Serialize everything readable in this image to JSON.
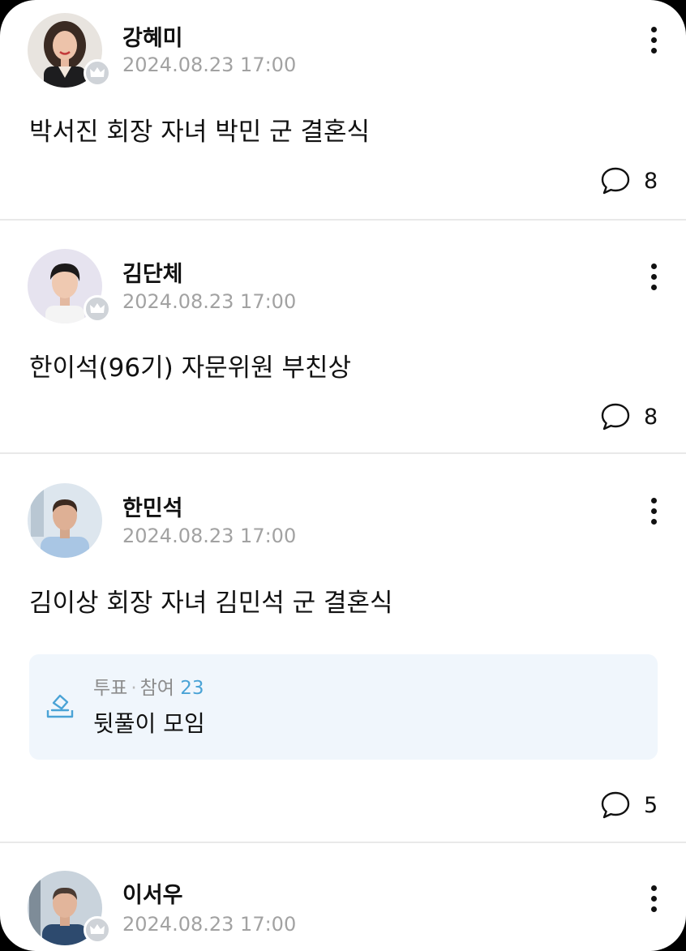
{
  "posts": [
    {
      "author": "강혜미",
      "date": "2024.08.23 17:00",
      "content": "박서진 회장 자녀 박민 군 결혼식",
      "comment_count": "8",
      "has_crown_badge": true
    },
    {
      "author": "김단체",
      "date": "2024.08.23 17:00",
      "content": "한이석(96기) 자문위원 부친상",
      "comment_count": "8",
      "has_crown_badge": true
    },
    {
      "author": "한민석",
      "date": "2024.08.23 17:00",
      "content": "김이상 회장 자녀 김민석 군 결혼식",
      "comment_count": "5",
      "has_crown_badge": false,
      "poll": {
        "type_label": "투표",
        "separator": "·",
        "participation_label": "참여",
        "participation_count": "23",
        "title": "뒷풀이 모임"
      }
    },
    {
      "author": "이서우",
      "date": "2024.08.23 17:00",
      "has_crown_badge": true
    }
  ],
  "icons": {
    "more": "more-vertical-icon",
    "comment": "speech-bubble-icon",
    "crown": "crown-icon",
    "poll": "ballot-box-icon"
  },
  "colors": {
    "poll_background": "#f0f6fc",
    "poll_accent": "#4aa3d6",
    "timestamp": "#a2a2a2",
    "divider": "#e9e9e9",
    "badge": "#cfd3d8"
  }
}
